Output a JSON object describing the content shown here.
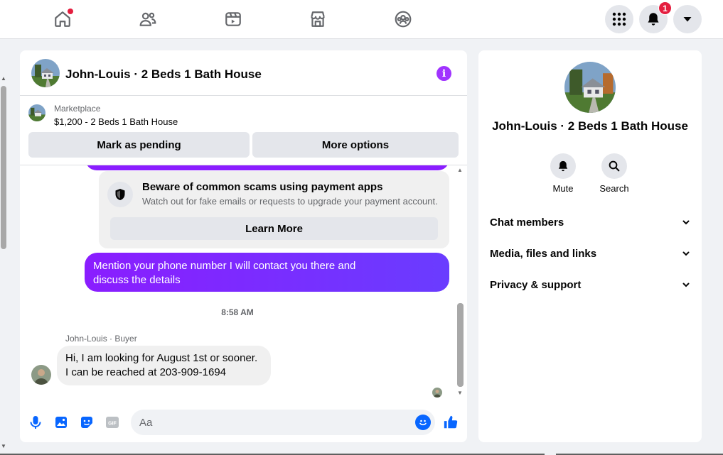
{
  "nav": {
    "notifications_count": "1"
  },
  "chat": {
    "title": "John-Louis · 2 Beds 1 Bath House",
    "marketplace": {
      "label": "Marketplace",
      "listing": "$1,200 - 2 Beds 1 Bath House",
      "mark_pending_label": "Mark as pending",
      "more_options_label": "More options"
    },
    "scam_notice": {
      "title": "Beware of common scams using payment apps",
      "subtitle": "Watch out for fake emails or requests to upgrade your payment account.",
      "button_label": "Learn More"
    },
    "messages": {
      "outgoing_text_line1": "Mention your phone number I will contact you there and",
      "outgoing_text_line2": "discuss the details",
      "timestamp": "8:58 AM",
      "incoming_sender": "John-Louis · Buyer",
      "incoming_text_line1": "Hi, I am looking for August 1st or sooner.",
      "incoming_text_line2": "I can be reached at 203-909-1694"
    },
    "composer": {
      "placeholder": "Aa"
    }
  },
  "panel": {
    "title": "John-Louis · 2 Beds 1 Bath House",
    "actions": {
      "mute_label": "Mute",
      "search_label": "Search"
    },
    "sections": {
      "members_label": "Chat members",
      "media_label": "Media, files and links",
      "privacy_label": "Privacy & support"
    }
  },
  "colors": {
    "accent_blue": "#0866ff",
    "message_purple": "#8a1dff",
    "badge_red": "#e41e3f"
  }
}
